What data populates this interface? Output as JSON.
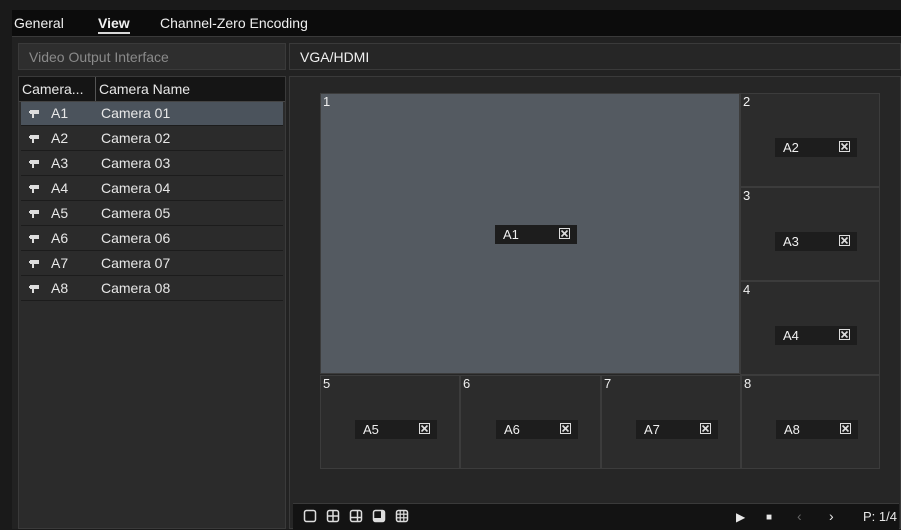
{
  "tabs": [
    "General",
    "View",
    "Channel-Zero Encoding"
  ],
  "active_tab": "View",
  "video_output": {
    "label": "Video Output Interface",
    "value": "VGA/HDMI"
  },
  "camera_list": {
    "headers": [
      "Camera...",
      "Camera Name"
    ],
    "rows": [
      {
        "id": "A1",
        "name": "Camera 01",
        "selected": true
      },
      {
        "id": "A2",
        "name": "Camera 02"
      },
      {
        "id": "A3",
        "name": "Camera 03"
      },
      {
        "id": "A4",
        "name": "Camera 04"
      },
      {
        "id": "A5",
        "name": "Camera 05"
      },
      {
        "id": "A6",
        "name": "Camera 06"
      },
      {
        "id": "A7",
        "name": "Camera 07"
      },
      {
        "id": "A8",
        "name": "Camera 08"
      }
    ]
  },
  "view_windows": [
    {
      "num": "1",
      "camera": "A1"
    },
    {
      "num": "2",
      "camera": "A2"
    },
    {
      "num": "3",
      "camera": "A3"
    },
    {
      "num": "4",
      "camera": "A4"
    },
    {
      "num": "5",
      "camera": "A5"
    },
    {
      "num": "6",
      "camera": "A6"
    },
    {
      "num": "7",
      "camera": "A7"
    },
    {
      "num": "8",
      "camera": "A8"
    }
  ],
  "remove_glyph": "☒",
  "layout_buttons": [
    "layout-1-icon",
    "layout-4-icon",
    "layout-6-icon",
    "layout-8-icon",
    "layout-9-icon"
  ],
  "controls": {
    "play": "▶",
    "stop": "■",
    "prev": "‹",
    "next": "›"
  },
  "page_indicator": "P: 1/4",
  "colors": {
    "selected_row": "#4b535c",
    "main_window": "#545a61"
  }
}
